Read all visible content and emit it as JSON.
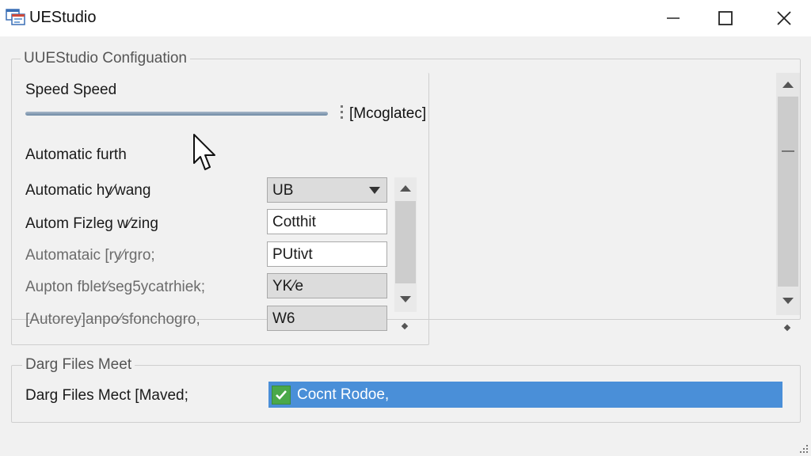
{
  "window": {
    "title": "UEStudio",
    "controls": {
      "minimize_icon": "minimize-icon",
      "maximize_icon": "maximize-icon",
      "close_icon": "close-icon"
    }
  },
  "config_group": {
    "legend": "UUEStudio Configuation",
    "speed": {
      "label": "Speed Speed",
      "slider_value": "[Mcoglatec]"
    },
    "section_label": "Automatic furth",
    "rows": [
      {
        "label": "Automatic hy⁄wang",
        "value": "UB",
        "kind": "combo"
      },
      {
        "label": "Autom Fizleg w⁄zing",
        "value": "Cotthit",
        "kind": "text"
      },
      {
        "label": "Automataic [ry⁄rgro;",
        "value": "PUtivt",
        "kind": "text"
      },
      {
        "label": "Aupton fblet⁄seg5ycatrhiek;",
        "value": "YK⁄e",
        "kind": "readonly"
      },
      {
        "label": "[Autorey]anpo⁄sfonchogro,",
        "value": "W6",
        "kind": "readonly"
      }
    ]
  },
  "files_group": {
    "legend": "Darg Files Meet",
    "label": "Darg Files Mect [Maved;",
    "status_text": "Cocnt Rodoe,",
    "status_icon": "check-icon"
  },
  "colors": {
    "accent": "#4a8fd8",
    "check": "#4aa84a",
    "titlebar": "#ffffff",
    "background": "#f1f1f1"
  }
}
